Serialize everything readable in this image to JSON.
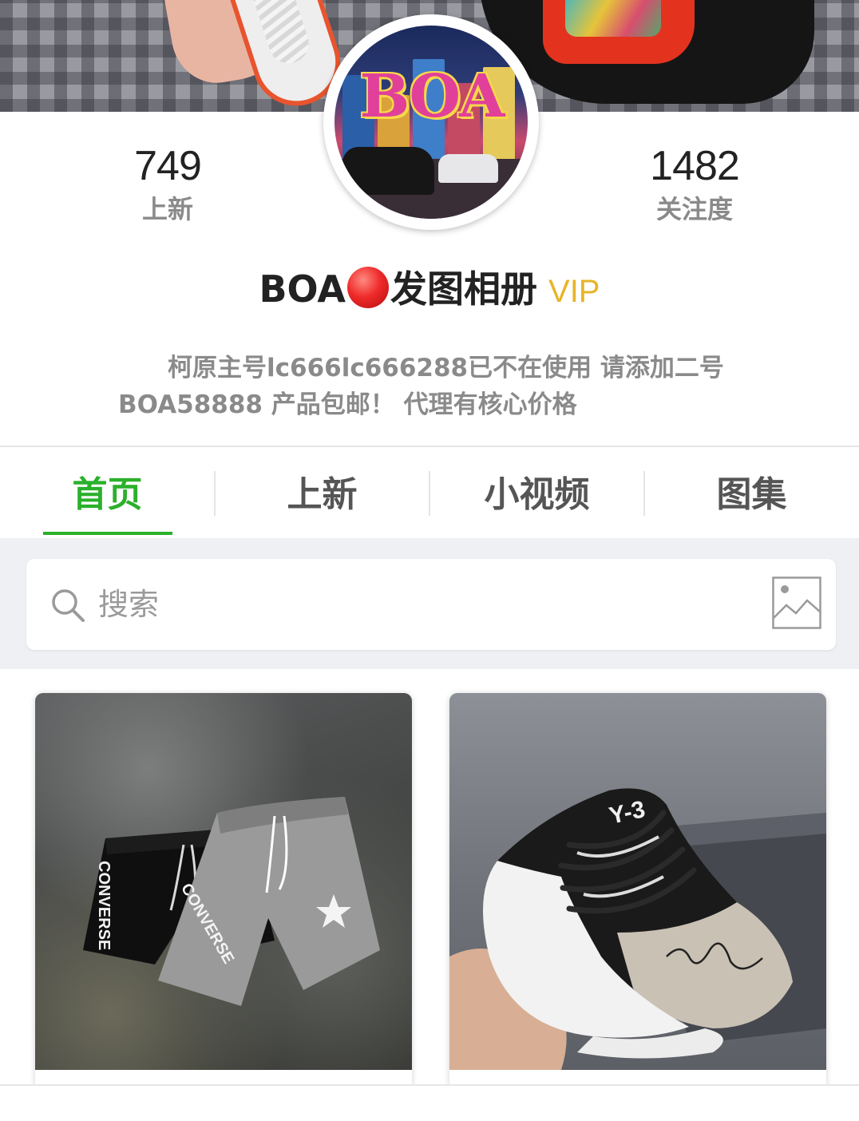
{
  "profile": {
    "new_count": "749",
    "new_label": "上新",
    "follow_count": "1482",
    "follow_label": "关注度",
    "name_prefix": "BOA",
    "name_suffix": "发图相册",
    "vip_label": "VIP",
    "description": "柯原主号lc666lc666288已不在使用 请添加二号BOA58888 产品包邮！ 代理有核心价格",
    "avatar_text": "BOA"
  },
  "tabs": [
    {
      "label": "首页",
      "active": true
    },
    {
      "label": "上新",
      "active": false
    },
    {
      "label": "小视频",
      "active": false
    },
    {
      "label": "图集",
      "active": false
    }
  ],
  "search": {
    "placeholder": "搜索",
    "search_icon": "search-icon",
    "image_icon": "image-icon"
  },
  "products": [
    {
      "name": "product-shorts"
    },
    {
      "name": "product-sneaker"
    }
  ],
  "colors": {
    "accent": "#2bb02b",
    "vip": "#e8b428"
  }
}
